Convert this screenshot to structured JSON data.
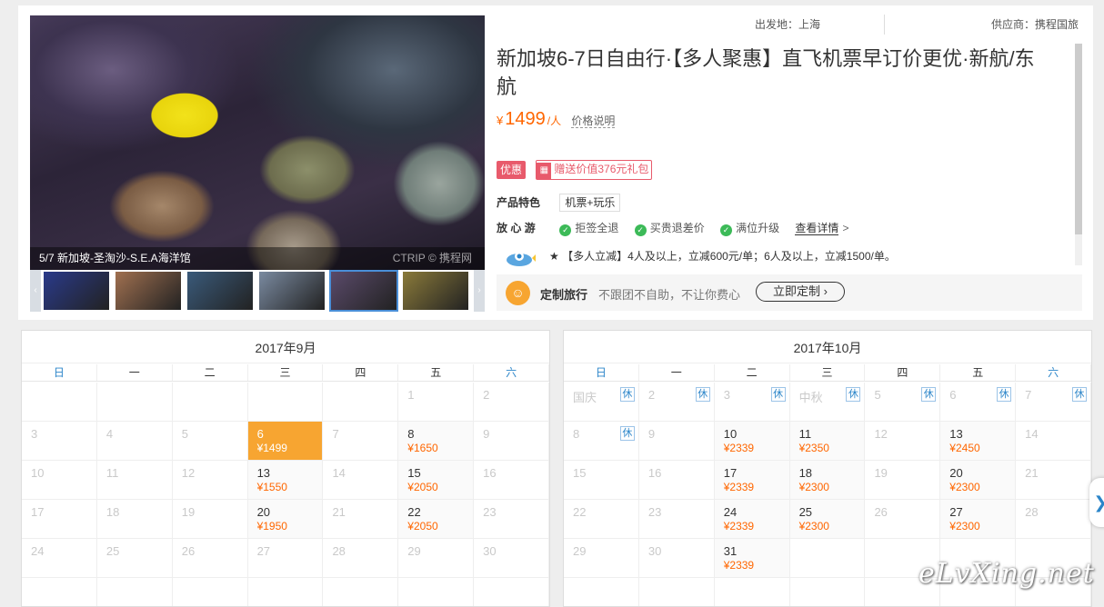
{
  "gallery": {
    "caption": "5/7 新加坡-圣淘沙-S.E.A海洋馆",
    "photo_watermark": "CTRIP © 携程网",
    "prev_arrow": "‹",
    "next_arrow": "›",
    "thumbs": [
      "#2a3a8a",
      "#a07050",
      "#3a5a7a",
      "#7a8aa0",
      "#5a4a6a",
      "#8a7a3a"
    ]
  },
  "product": {
    "departure": "出发地：上海",
    "supplier": "供应商：携程国旅",
    "title": "新加坡6-7日自由行·【多人聚惠】直飞机票早订价更优·新航/东航",
    "price_currency": "¥",
    "price": "1499",
    "price_unit": "/人",
    "price_explain": "价格说明",
    "promo_badge": "优惠",
    "gift_text": "赠送价值376元礼包",
    "feature_label": "产品特色",
    "feature_tag": "机票+玩乐",
    "assure_label": "放 心 游",
    "assure_items": [
      "拒签全退",
      "买贵退差价",
      "满位升级"
    ],
    "detail_link": "查看详情",
    "detail_arrow": ">",
    "notice": "★ 【多人立减】4人及以上，立减600元/单；6人及以上，立减1500/单。"
  },
  "custom": {
    "title": "定制旅行",
    "desc": "不跟团不自助，不让你费心",
    "button": "立即定制 ›"
  },
  "calendar_weekdays": [
    "日",
    "一",
    "二",
    "三",
    "四",
    "五",
    "六"
  ],
  "calendar_rest_label": "休",
  "calendars": [
    {
      "title": "2017年9月",
      "weeks": [
        [
          {
            "d": ""
          },
          {
            "d": ""
          },
          {
            "d": ""
          },
          {
            "d": ""
          },
          {
            "d": ""
          },
          {
            "d": "1"
          },
          {
            "d": "2"
          }
        ],
        [
          {
            "d": "3"
          },
          {
            "d": "4"
          },
          {
            "d": "5"
          },
          {
            "d": "6",
            "p": "¥1499",
            "sel": true
          },
          {
            "d": "7"
          },
          {
            "d": "8",
            "p": "¥1650"
          },
          {
            "d": "9"
          }
        ],
        [
          {
            "d": "10"
          },
          {
            "d": "11"
          },
          {
            "d": "12"
          },
          {
            "d": "13",
            "p": "¥1550"
          },
          {
            "d": "14"
          },
          {
            "d": "15",
            "p": "¥2050"
          },
          {
            "d": "16"
          }
        ],
        [
          {
            "d": "17"
          },
          {
            "d": "18"
          },
          {
            "d": "19"
          },
          {
            "d": "20",
            "p": "¥1950"
          },
          {
            "d": "21"
          },
          {
            "d": "22",
            "p": "¥2050"
          },
          {
            "d": "23"
          }
        ],
        [
          {
            "d": "24"
          },
          {
            "d": "25"
          },
          {
            "d": "26"
          },
          {
            "d": "27"
          },
          {
            "d": "28"
          },
          {
            "d": "29"
          },
          {
            "d": "30"
          }
        ],
        [
          {
            "d": ""
          },
          {
            "d": ""
          },
          {
            "d": ""
          },
          {
            "d": ""
          },
          {
            "d": ""
          },
          {
            "d": ""
          },
          {
            "d": ""
          }
        ]
      ]
    },
    {
      "title": "2017年10月",
      "weeks": [
        [
          {
            "d": "国庆",
            "rest": true
          },
          {
            "d": "2",
            "rest": true
          },
          {
            "d": "3",
            "rest": true
          },
          {
            "d": "中秋",
            "rest": true
          },
          {
            "d": "5",
            "rest": true
          },
          {
            "d": "6",
            "rest": true
          },
          {
            "d": "7",
            "rest": true
          }
        ],
        [
          {
            "d": "8",
            "rest": true
          },
          {
            "d": "9"
          },
          {
            "d": "10",
            "p": "¥2339"
          },
          {
            "d": "11",
            "p": "¥2350"
          },
          {
            "d": "12"
          },
          {
            "d": "13",
            "p": "¥2450"
          },
          {
            "d": "14"
          }
        ],
        [
          {
            "d": "15"
          },
          {
            "d": "16"
          },
          {
            "d": "17",
            "p": "¥2339"
          },
          {
            "d": "18",
            "p": "¥2300"
          },
          {
            "d": "19"
          },
          {
            "d": "20",
            "p": "¥2300"
          },
          {
            "d": "21"
          }
        ],
        [
          {
            "d": "22"
          },
          {
            "d": "23"
          },
          {
            "d": "24",
            "p": "¥2339"
          },
          {
            "d": "25",
            "p": "¥2300"
          },
          {
            "d": "26"
          },
          {
            "d": "27",
            "p": "¥2300"
          },
          {
            "d": "28"
          }
        ],
        [
          {
            "d": "29"
          },
          {
            "d": "30"
          },
          {
            "d": "31",
            "p": "¥2339"
          },
          {
            "d": ""
          },
          {
            "d": ""
          },
          {
            "d": ""
          },
          {
            "d": ""
          }
        ],
        [
          {
            "d": ""
          },
          {
            "d": ""
          },
          {
            "d": ""
          },
          {
            "d": ""
          },
          {
            "d": ""
          },
          {
            "d": ""
          },
          {
            "d": ""
          }
        ]
      ]
    }
  ],
  "side_arrow": "❯",
  "watermark": "eLvXing.net",
  "colors": {
    "accent": "#ff6600",
    "selected": "#f7a531",
    "weekend": "#2b85c9",
    "promo": "#e85a6b",
    "check": "#3cba58"
  }
}
